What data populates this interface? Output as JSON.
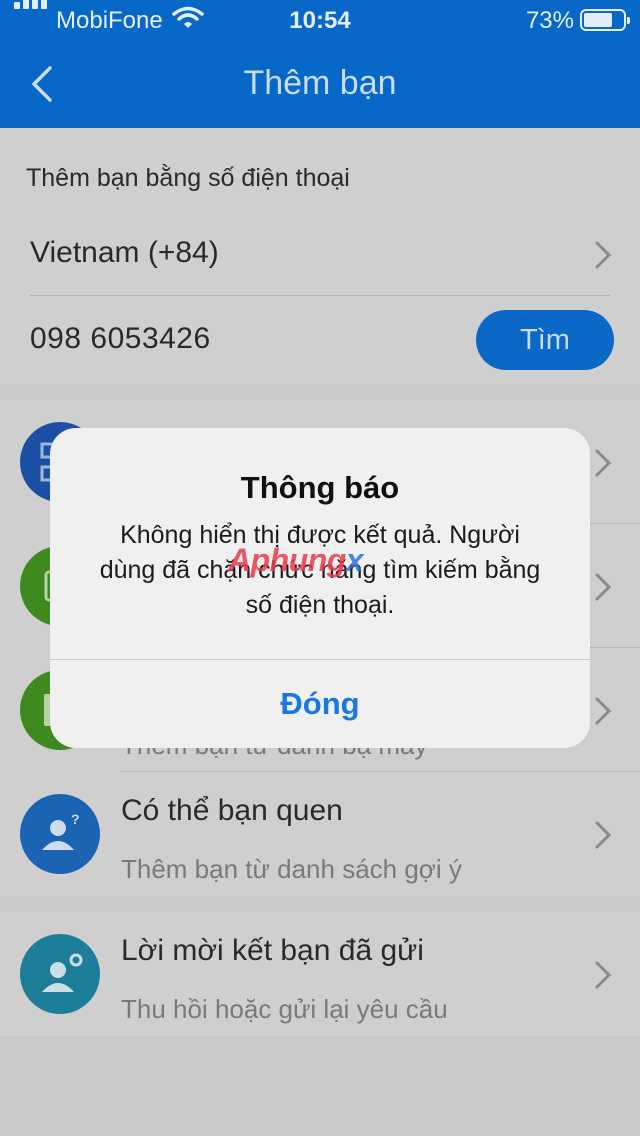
{
  "status_bar": {
    "carrier": "MobiFone",
    "time": "10:54",
    "battery": "73%",
    "battery_level": 0.73
  },
  "nav": {
    "title": "Thêm bạn",
    "back_icon": "chevron-left-icon"
  },
  "add_by_phone": {
    "section_label": "Thêm bạn bằng số điện thoại",
    "country": "Vietnam (+84)",
    "phone": "098 6053426",
    "search_button": "Tìm"
  },
  "options": [
    {
      "title": "",
      "subtitle": "",
      "icon": "qr-code-icon",
      "color": "#1c4fa3"
    },
    {
      "title": "",
      "subtitle": "",
      "icon": "contacts-sync-icon",
      "color": "#3f8a1f"
    },
    {
      "title": "",
      "subtitle": "Thêm bạn từ danh bạ máy",
      "icon": "phonebook-icon",
      "color": "#3f8a1f"
    },
    {
      "title": "Có thể bạn quen",
      "subtitle": "Thêm bạn từ danh sách gợi ý",
      "icon": "people-suggest-icon",
      "color": "#1b64b3"
    },
    {
      "title": "Lời mời kết bạn đã gửi",
      "subtitle": "Thu hồi hoặc gửi lại yêu cầu",
      "icon": "friend-request-icon",
      "color": "#1c7e98"
    }
  ],
  "alert": {
    "title": "Thông báo",
    "message": "Không hiển thị được kết quả. Người dùng đã chặn chức năng tìm kiếm bằng số điện thoại.",
    "button": "Đóng",
    "watermark": "Aphungx"
  }
}
